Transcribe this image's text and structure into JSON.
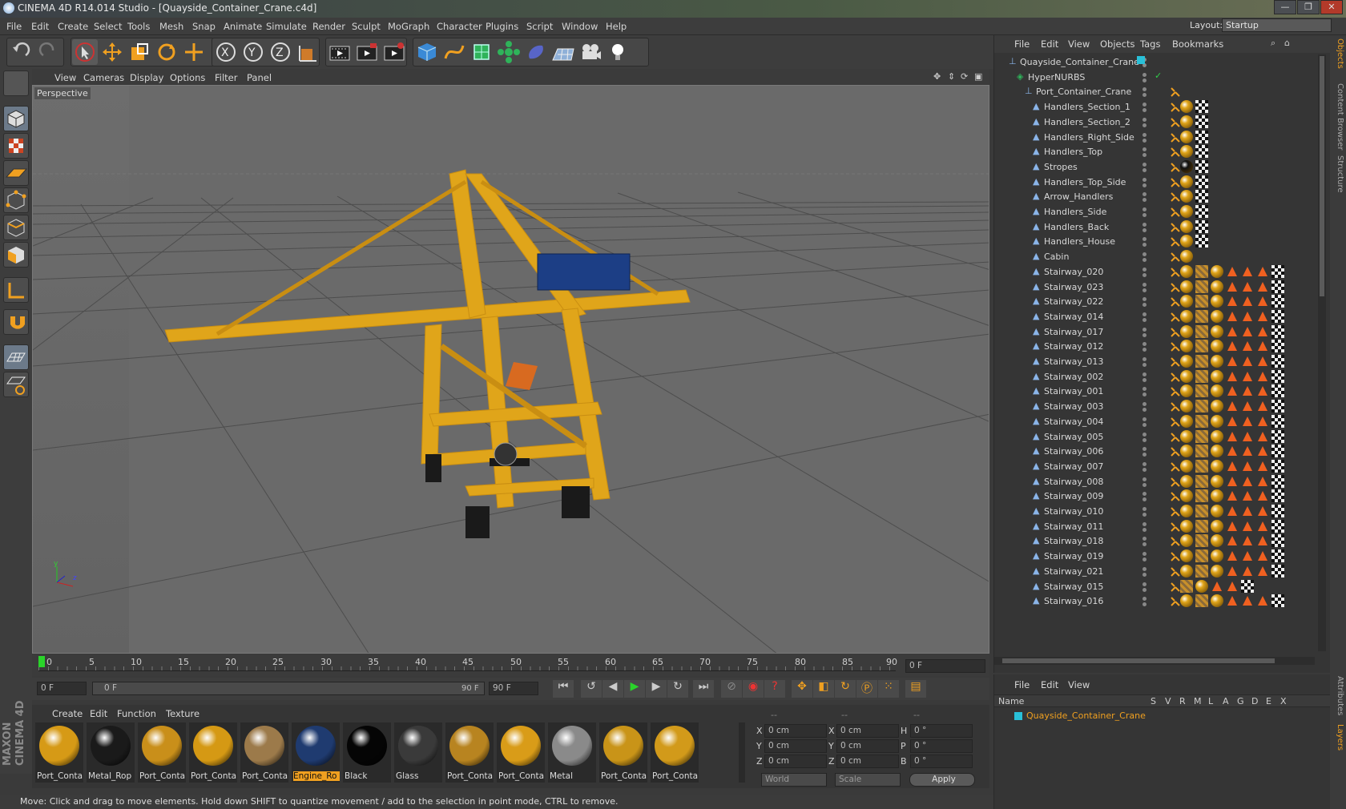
{
  "window": {
    "title": "CINEMA 4D R14.014 Studio - [Quayside_Container_Crane.c4d]",
    "buttons": [
      "—",
      "❐",
      "✕"
    ]
  },
  "menu": {
    "items": [
      "File",
      "Edit",
      "Create",
      "Select",
      "Tools",
      "Mesh",
      "Snap",
      "Animate",
      "Simulate",
      "Render",
      "Sculpt",
      "MoGraph",
      "Character",
      "Plugins",
      "Script",
      "Window",
      "Help"
    ],
    "layout_label": "Layout:",
    "layout_value": "Startup"
  },
  "viewport": {
    "menu": [
      "View",
      "Cameras",
      "Display",
      "Options",
      "Filter",
      "Panel"
    ],
    "label": "Perspective",
    "axis_y": "y",
    "axis_z": "z"
  },
  "timeline": {
    "ticks": [
      "0",
      "5",
      "10",
      "15",
      "20",
      "25",
      "30",
      "35",
      "40",
      "45",
      "50",
      "55",
      "60",
      "65",
      "70",
      "75",
      "80",
      "85",
      "90"
    ],
    "frame_field": "0 F"
  },
  "playbar": {
    "start": "0 F",
    "range_start": "0 F",
    "range_end": "90 F",
    "end": "90 F"
  },
  "materials": {
    "menu": [
      "Create",
      "Edit",
      "Function",
      "Texture"
    ],
    "items": [
      {
        "label": "Port_Conta",
        "color": "#d69a16"
      },
      {
        "label": "Metal_Rop",
        "color": "#1a1a1a"
      },
      {
        "label": "Port_Conta",
        "color": "#c98f1a"
      },
      {
        "label": "Port_Conta",
        "color": "#d59914"
      },
      {
        "label": "Port_Conta",
        "color": "#9c7a4a"
      },
      {
        "label": "Engine_Ro",
        "color": "#1f3b70",
        "selected": true
      },
      {
        "label": "Black",
        "color": "#050505"
      },
      {
        "label": "Glass",
        "color": "#3a3a3a"
      },
      {
        "label": "Port_Conta",
        "color": "#b88420"
      },
      {
        "label": "Port_Conta",
        "color": "#d99c18"
      },
      {
        "label": "Metal",
        "color": "#8a8a8a"
      },
      {
        "label": "Port_Conta",
        "color": "#c99418"
      },
      {
        "label": "Port_Conta",
        "color": "#d29a1a"
      }
    ]
  },
  "coords": {
    "header": [
      "--",
      "--",
      "--"
    ],
    "rows": [
      [
        "X",
        "0 cm",
        "X",
        "0 cm",
        "H",
        "0 °"
      ],
      [
        "Y",
        "0 cm",
        "Y",
        "0 cm",
        "P",
        "0 °"
      ],
      [
        "Z",
        "0 cm",
        "Z",
        "0 cm",
        "B",
        "0 °"
      ]
    ],
    "world": "World",
    "scale": "Scale",
    "apply": "Apply"
  },
  "status": "Move: Click and drag to move elements. Hold down SHIFT to quantize movement / add to the selection in point mode, CTRL to remove.",
  "objects": {
    "menu": [
      "File",
      "Edit",
      "View",
      "Objects",
      "Tags",
      "Bookmarks"
    ],
    "items": [
      {
        "name": "Quayside_Container_Crane",
        "level": 0,
        "tags": "root"
      },
      {
        "name": "HyperNURBS",
        "level": 1,
        "tags": "check"
      },
      {
        "name": "Port_Container_Crane",
        "level": 2,
        "tags": "none"
      },
      {
        "name": "Handlers_Section_1",
        "level": 3,
        "tags": "two"
      },
      {
        "name": "Handlers_Section_2",
        "level": 3,
        "tags": "two"
      },
      {
        "name": "Handlers_Right_Side",
        "level": 3,
        "tags": "two"
      },
      {
        "name": "Handlers_Top",
        "level": 3,
        "tags": "two"
      },
      {
        "name": "Stropes",
        "level": 3,
        "tags": "blk"
      },
      {
        "name": "Handlers_Top_Side",
        "level": 3,
        "tags": "two"
      },
      {
        "name": "Arrow_Handlers",
        "level": 3,
        "tags": "two"
      },
      {
        "name": "Handlers_Side",
        "level": 3,
        "tags": "two"
      },
      {
        "name": "Handlers_Back",
        "level": 3,
        "tags": "two"
      },
      {
        "name": "Handlers_House",
        "level": 3,
        "tags": "two"
      },
      {
        "name": "Cabin",
        "level": 3,
        "tags": "one"
      },
      {
        "name": "Stairway_020",
        "level": 3,
        "tags": "many"
      },
      {
        "name": "Stairway_023",
        "level": 3,
        "tags": "many"
      },
      {
        "name": "Stairway_022",
        "level": 3,
        "tags": "many"
      },
      {
        "name": "Stairway_014",
        "level": 3,
        "tags": "many"
      },
      {
        "name": "Stairway_017",
        "level": 3,
        "tags": "many"
      },
      {
        "name": "Stairway_012",
        "level": 3,
        "tags": "many"
      },
      {
        "name": "Stairway_013",
        "level": 3,
        "tags": "many"
      },
      {
        "name": "Stairway_002",
        "level": 3,
        "tags": "many"
      },
      {
        "name": "Stairway_001",
        "level": 3,
        "tags": "many"
      },
      {
        "name": "Stairway_003",
        "level": 3,
        "tags": "many"
      },
      {
        "name": "Stairway_004",
        "level": 3,
        "tags": "many"
      },
      {
        "name": "Stairway_005",
        "level": 3,
        "tags": "many"
      },
      {
        "name": "Stairway_006",
        "level": 3,
        "tags": "many"
      },
      {
        "name": "Stairway_007",
        "level": 3,
        "tags": "many"
      },
      {
        "name": "Stairway_008",
        "level": 3,
        "tags": "many"
      },
      {
        "name": "Stairway_009",
        "level": 3,
        "tags": "many"
      },
      {
        "name": "Stairway_010",
        "level": 3,
        "tags": "many"
      },
      {
        "name": "Stairway_011",
        "level": 3,
        "tags": "many"
      },
      {
        "name": "Stairway_018",
        "level": 3,
        "tags": "many"
      },
      {
        "name": "Stairway_019",
        "level": 3,
        "tags": "many"
      },
      {
        "name": "Stairway_021",
        "level": 3,
        "tags": "many"
      },
      {
        "name": "Stairway_015",
        "level": 3,
        "tags": "few"
      },
      {
        "name": "Stairway_016",
        "level": 3,
        "tags": "many"
      }
    ]
  },
  "layers": {
    "menu": [
      "File",
      "Edit",
      "View"
    ],
    "columns": [
      "Name",
      "S",
      "V",
      "R",
      "M",
      "L",
      "A",
      "G",
      "D",
      "E",
      "X"
    ],
    "item": "Quayside_Container_Crane"
  },
  "sidetabs": [
    "Objects",
    "Content Browser",
    "Structure",
    "Attributes",
    "Layers"
  ],
  "logo": "MAXON CINEMA 4D"
}
